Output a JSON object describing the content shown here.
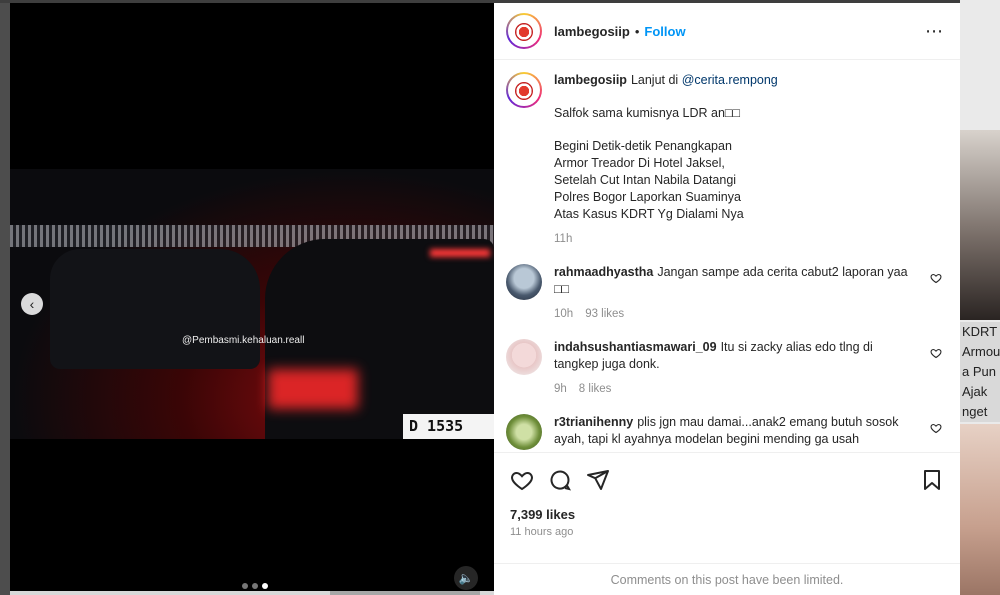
{
  "background_feed": {
    "lines": [
      "KDRT",
      "Armou",
      "a Pun",
      "Ajak",
      "nget"
    ]
  },
  "media": {
    "watermark": "@Pembasmi.kehaluan.reall",
    "plate_text": "D 1535",
    "prev_icon": "chevron-left-icon",
    "mute_icon": "speaker-icon"
  },
  "header": {
    "username": "lambegosiip",
    "separator": "•",
    "follow_label": "Follow",
    "more_label": "⋯"
  },
  "caption": {
    "username": "lambegosiip",
    "intro": "Lanjut di",
    "mention": "@cerita.rempong",
    "line2": "Salfok sama kumisnya LDR an□□",
    "paragraph": [
      "Begini Detik-detik Penangkapan",
      "Armor Treador Di Hotel Jaksel,",
      "Setelah Cut Intan Nabila Datangi",
      "Polres Bogor Laporkan Suaminya",
      "Atas Kasus KDRT Yg Dialami Nya"
    ],
    "time": "11h"
  },
  "comments": [
    {
      "username": "rahmaadhyastha",
      "text": "Jangan sampe ada cerita cabut2 laporan yaa □□",
      "time": "10h",
      "likes": "93 likes"
    },
    {
      "username": "indahsushantiasmawari_09",
      "text": "Itu si zacky alias edo tlng di tangkep juga donk.",
      "time": "9h",
      "likes": "8 likes"
    },
    {
      "username": "r3trianihenny",
      "text": "plis jgn mau damai...anak2 emang butuh sosok ayah, tapi kl ayahnya modelan begini mending ga usah",
      "time": "",
      "likes": ""
    }
  ],
  "actions": {
    "likes_count": "7,399 likes",
    "posted": "11 hours ago"
  },
  "footer": {
    "limited_text": "Comments on this post have been limited."
  },
  "colors": {
    "accent": "#0095f6",
    "text": "#262626",
    "muted": "#8e8e8e",
    "link": "#00376b"
  }
}
